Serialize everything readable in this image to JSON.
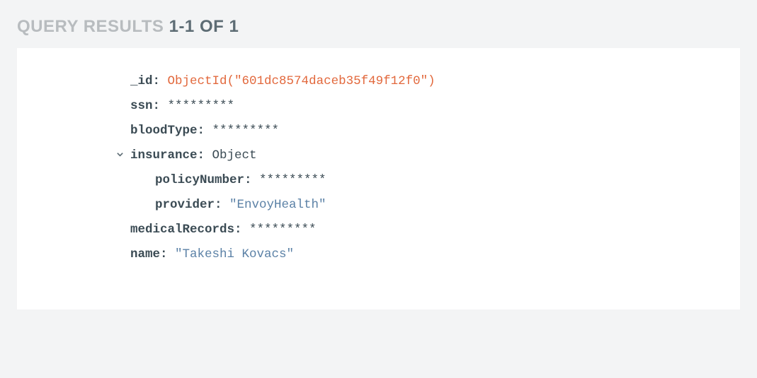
{
  "header": {
    "prefix": "QUERY RESULTS ",
    "count": "1-1 OF 1"
  },
  "doc": {
    "fields": {
      "id_key": "_id",
      "id_val": "ObjectId(\"601dc8574daceb35f49f12f0\")",
      "ssn_key": "ssn",
      "ssn_val": "*********",
      "bloodType_key": "bloodType",
      "bloodType_val": "*********",
      "insurance_key": "insurance",
      "insurance_val": "Object",
      "policyNumber_key": "policyNumber",
      "policyNumber_val": "*********",
      "provider_key": "provider",
      "provider_val": "\"EnvoyHealth\"",
      "medicalRecords_key": "medicalRecords",
      "medicalRecords_val": "*********",
      "name_key": "name",
      "name_val": "\"Takeshi Kovacs\""
    }
  }
}
